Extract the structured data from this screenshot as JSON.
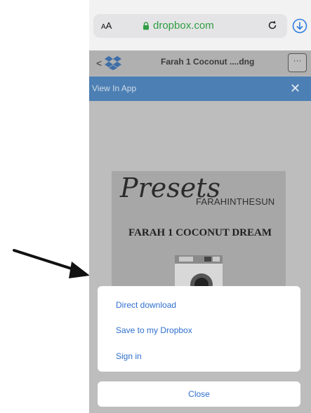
{
  "browser": {
    "text_size_label": "AA",
    "domain": "dropbox.com",
    "icons": [
      "lock-icon",
      "reload-icon",
      "download-icon"
    ]
  },
  "dropbox": {
    "back_label": "<",
    "file_name": "Farah 1 Coconut ....dng",
    "more_label": "···"
  },
  "banner": {
    "text": "View In App",
    "close_label": "✕"
  },
  "preview": {
    "script_title": "Presets",
    "brand": "FARAHINTHESUN",
    "product_title": "FARAH 1 COCONUT DREAM"
  },
  "sheet": {
    "items": [
      {
        "label": "Direct download"
      },
      {
        "label": "Save to my Dropbox"
      },
      {
        "label": "Sign in"
      }
    ],
    "close_label": "Close"
  },
  "colors": {
    "link": "#2f6fce",
    "banner": "#4c7fb3",
    "lock_green": "#2f9e44"
  }
}
